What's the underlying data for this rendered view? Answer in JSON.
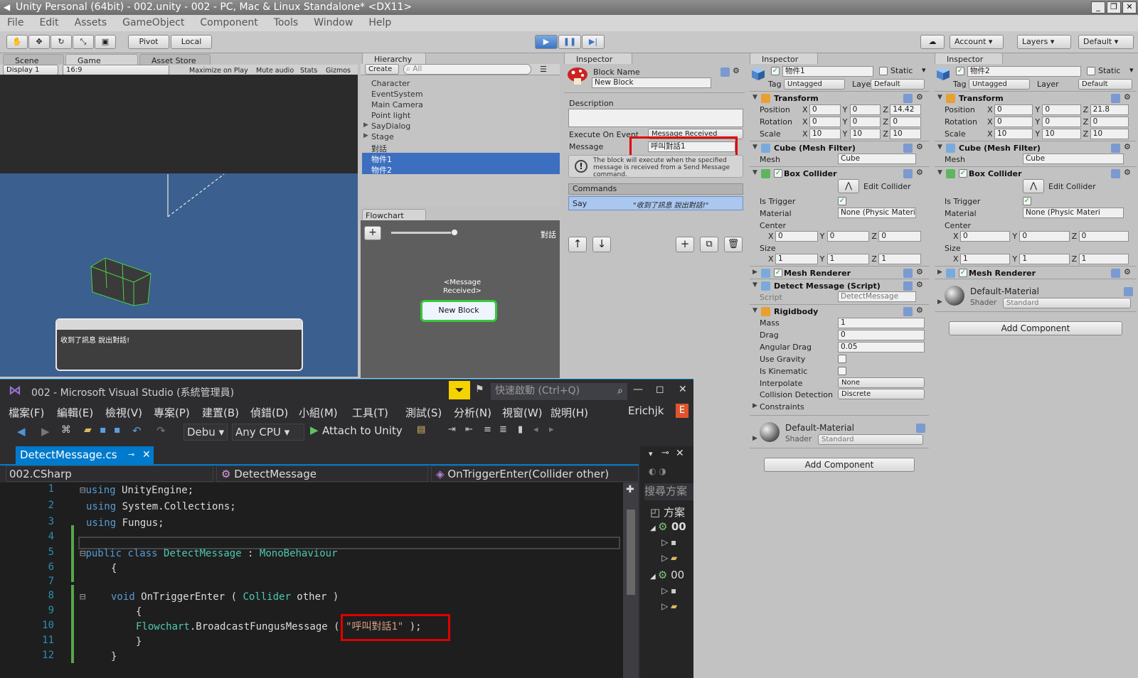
{
  "window": {
    "title": "Unity Personal (64bit) - 002.unity - 002 - PC, Mac & Linux Standalone* <DX11>"
  },
  "menu": [
    "File",
    "Edit",
    "Assets",
    "GameObject",
    "Component",
    "Tools",
    "Window",
    "Help"
  ],
  "toolbar": {
    "pivot": "Pivot",
    "local": "Local",
    "account": "Account",
    "layers": "Layers",
    "layout": "Default"
  },
  "scene_tabs": {
    "scene": "Scene",
    "game": "Game",
    "asset_store": "Asset Store"
  },
  "game_bar": {
    "display": "Display 1",
    "aspect": "16:9",
    "maximize": "Maximize on Play",
    "mute": "Mute audio",
    "stats": "Stats",
    "gizmos": "Gizmos"
  },
  "game": {
    "dialog_text": "收到了訊息 說出對話!"
  },
  "hierarchy": {
    "tab": "Hierarchy",
    "create": "Create",
    "search_placeholder": "All",
    "items": [
      "Character",
      "EventSystem",
      "Main Camera",
      "Point light",
      "SayDialog",
      "Stage",
      "對話",
      "物件1",
      "物件2"
    ]
  },
  "flowchart": {
    "tab": "Flowchart",
    "name": "對話",
    "event_label": "<Message Received>",
    "block": "New Block"
  },
  "block_inspector": {
    "tab": "Inspector",
    "block_name_label": "Block Name",
    "block_name": "New Block",
    "description_label": "Description",
    "execute_label": "Execute On Event",
    "execute_value": "Message Received",
    "message_label": "Message",
    "message_value": "呼叫對話1",
    "help": "The block will execute when the specified message is received from a Send Message command.",
    "commands_label": "Commands",
    "command_name": "Say",
    "command_value": "\"收到了訊息 說出對話!\""
  },
  "insp1": {
    "tab": "Inspector",
    "name": "物件1",
    "static": "Static",
    "tag_label": "Tag",
    "tag": "Untagged",
    "layer_label": "Layer",
    "layer": "Default",
    "transform": "Transform",
    "position": "Position",
    "rotation": "Rotation",
    "scale": "Scale",
    "pos": [
      "0",
      "0",
      "14.42"
    ],
    "rot": [
      "0",
      "0",
      "0"
    ],
    "scl": [
      "10",
      "10",
      "10"
    ],
    "mesh_filter": "Cube (Mesh Filter)",
    "mesh_label": "Mesh",
    "mesh": "Cube",
    "box_collider": "Box Collider",
    "edit_collider": "Edit Collider",
    "is_trigger": "Is Trigger",
    "material_label": "Material",
    "material": "None (Physic Materi",
    "center": "Center",
    "c": [
      "0",
      "0",
      "0"
    ],
    "size": "Size",
    "s": [
      "1",
      "1",
      "1"
    ],
    "mesh_renderer": "Mesh Renderer",
    "detect": "Detect Message (Script)",
    "script_label": "Script",
    "script": "DetectMessage",
    "rigidbody": "Rigidbody",
    "mass_label": "Mass",
    "mass": "1",
    "drag_label": "Drag",
    "drag": "0",
    "adrag_label": "Angular Drag",
    "adrag": "0.05",
    "gravity": "Use Gravity",
    "kinematic": "Is Kinematic",
    "interp_label": "Interpolate",
    "interp": "None",
    "coll_label": "Collision Detection",
    "coll": "Discrete",
    "constraints": "Constraints",
    "mat_name": "Default-Material",
    "shader_label": "Shader",
    "shader": "Standard",
    "add_component": "Add Component"
  },
  "insp2": {
    "tab": "Inspector",
    "name": "物件2",
    "static": "Static",
    "tag_label": "Tag",
    "tag": "Untagged",
    "layer_label": "Layer",
    "layer": "Default",
    "transform": "Transform",
    "position": "Position",
    "rotation": "Rotation",
    "scale": "Scale",
    "pos": [
      "0",
      "0",
      "21.8"
    ],
    "rot": [
      "0",
      "0",
      "0"
    ],
    "scl": [
      "10",
      "10",
      "10"
    ],
    "mesh_filter": "Cube (Mesh Filter)",
    "mesh_label": "Mesh",
    "mesh": "Cube",
    "box_collider": "Box Collider",
    "edit_collider": "Edit Collider",
    "is_trigger": "Is Trigger",
    "material_label": "Material",
    "material": "None (Physic Materi",
    "center": "Center",
    "c": [
      "0",
      "0",
      "0"
    ],
    "size": "Size",
    "s": [
      "1",
      "1",
      "1"
    ],
    "mesh_renderer": "Mesh Renderer",
    "mat_name": "Default-Material",
    "shader_label": "Shader",
    "shader": "Standard",
    "add_component": "Add Component"
  },
  "vs": {
    "title": "002 - Microsoft Visual Studio (系統管理員)",
    "quick_launch": "快速啟動 (Ctrl+Q)",
    "menu": [
      "檔案(F)",
      "編輯(E)",
      "檢視(V)",
      "專案(P)",
      "建置(B)",
      "偵錯(D)",
      "小組(M)",
      "工具(T)",
      "測試(S)",
      "分析(N)",
      "視窗(W)",
      "說明(H)"
    ],
    "user": "Erichjk",
    "user_badge": "E",
    "config": "Debu",
    "platform": "Any CPU",
    "attach": "Attach to Unity",
    "file_tab": "DetectMessage.cs",
    "project_nav": "002.CSharp",
    "class_nav": "DetectMessage",
    "member_nav": "OnTriggerEnter(Collider other)",
    "line_numbers": [
      "1",
      "2",
      "3",
      "4",
      "5",
      "6",
      "7",
      "8",
      "9",
      "10",
      "11",
      "12"
    ],
    "code": {
      "l1a": "using",
      "l1b": " UnityEngine;",
      "l2a": "using",
      "l2b": " System.Collections;",
      "l3a": "using",
      "l3b": " Fungus;",
      "l5a": "public",
      "l5b": "class",
      "l5c": "DetectMessage",
      "l5d": " : ",
      "l5e": "MonoBehaviour",
      "l6": "{",
      "l8a": "void",
      "l8b": " OnTriggerEnter ( ",
      "l8c": "Collider",
      "l8d": " other )",
      "l9": "{",
      "l10a": "Flowchart",
      "l10b": ".BroadcastFungusMessage ",
      "l10c": "( ",
      "l10d": "\"呼叫對話1\"",
      "l10e": " );",
      "l11": "}",
      "l12": "}"
    },
    "solution_search": "搜尋方案",
    "solution_label": "方案",
    "sol_item1": "00",
    "sol_item2": "00"
  }
}
